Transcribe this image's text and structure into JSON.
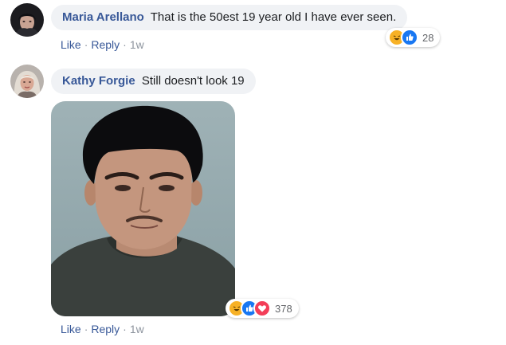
{
  "comments": [
    {
      "author": "Maria Arellano",
      "text": "That is the 50est 19 year old I have ever seen.",
      "actions": {
        "like": "Like",
        "reply": "Reply",
        "time": "1w"
      },
      "reactions": {
        "icons": [
          "haha-icon",
          "like-icon"
        ],
        "count": "28"
      }
    },
    {
      "author": "Kathy Forgie",
      "text": "Still doesn't look 19",
      "actions": {
        "like": "Like",
        "reply": "Reply",
        "time": "1w"
      },
      "reactions": {
        "icons": [
          "haha-icon",
          "like-icon",
          "love-icon"
        ],
        "count": "378"
      }
    }
  ],
  "separator": "·",
  "colors": {
    "author": "#385898",
    "bubble": "#f0f2f5",
    "text": "#1c1e21",
    "meta": "#8d949e"
  }
}
